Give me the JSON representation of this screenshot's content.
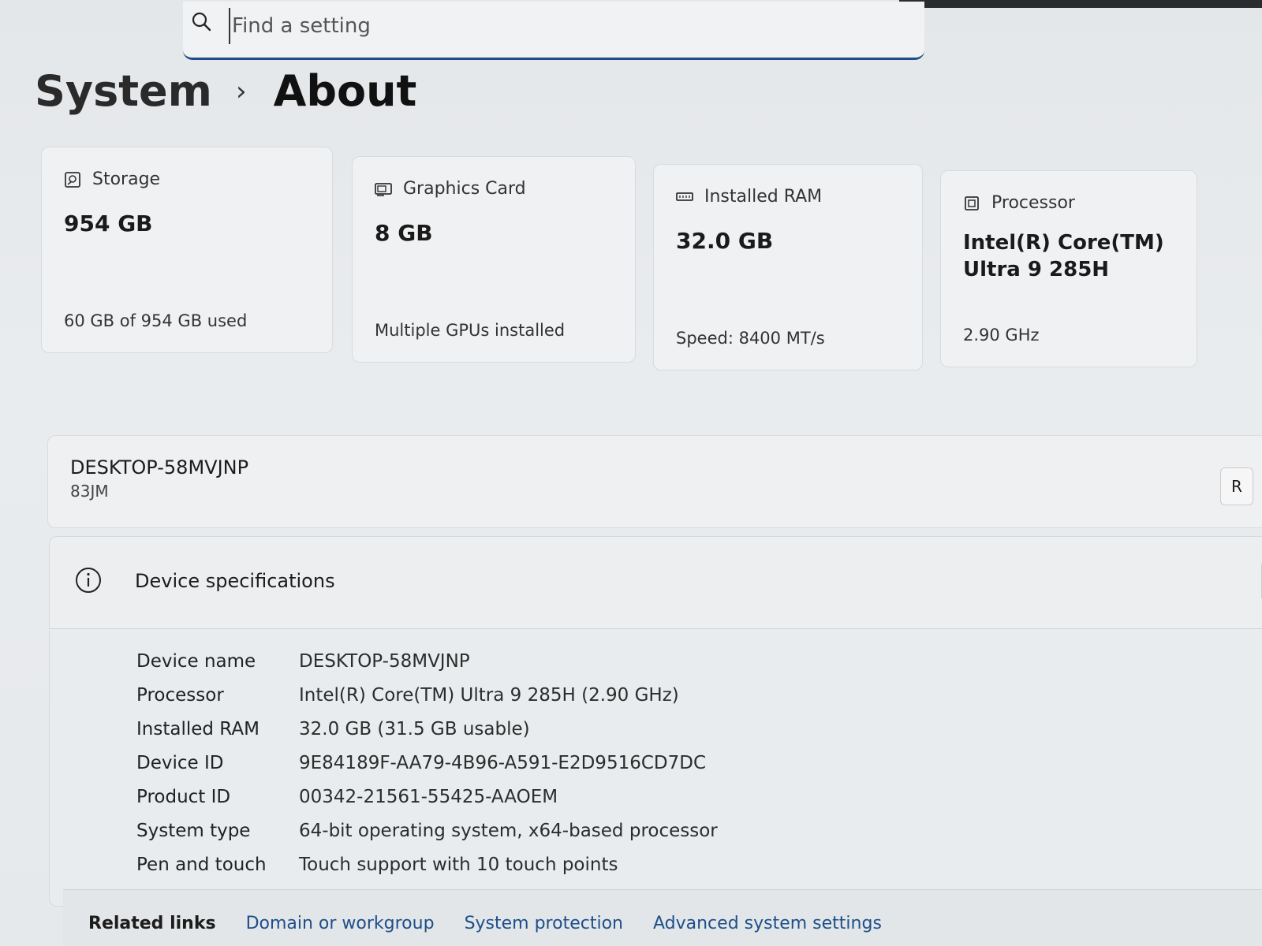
{
  "search": {
    "placeholder": "Find a setting"
  },
  "breadcrumb": {
    "parent": "System",
    "separator": "›",
    "current": "About"
  },
  "cards": [
    {
      "icon": "storage-icon",
      "label": "Storage",
      "value": "954 GB",
      "sub": "60 GB of 954 GB used"
    },
    {
      "icon": "graphics-card-icon",
      "label": "Graphics Card",
      "value": "8 GB",
      "sub": "Multiple GPUs installed"
    },
    {
      "icon": "ram-icon",
      "label": "Installed RAM",
      "value": "32.0 GB",
      "sub": "Speed: 8400 MT/s"
    },
    {
      "icon": "processor-icon",
      "label": "Processor",
      "value": "Intel(R) Core(TM) Ultra 9 285H",
      "sub": "2.90 GHz"
    }
  ],
  "device": {
    "name": "DESKTOP-58MVJNP",
    "model": "83JM",
    "rename_label": "R"
  },
  "specs": {
    "title": "Device specifications",
    "rows": [
      {
        "key": "Device name",
        "value": "DESKTOP-58MVJNP"
      },
      {
        "key": "Processor",
        "value": "Intel(R) Core(TM) Ultra 9 285H (2.90 GHz)"
      },
      {
        "key": "Installed RAM",
        "value": "32.0 GB (31.5 GB usable)"
      },
      {
        "key": "Device ID",
        "value": "9E84189F-AA79-4B96-A591-E2D9516CD7DC"
      },
      {
        "key": "Product ID",
        "value": "00342-21561-55425-AAOEM"
      },
      {
        "key": "System type",
        "value": "64-bit operating system, x64-based processor"
      },
      {
        "key": "Pen and touch",
        "value": "Touch support with 10 touch points"
      }
    ]
  },
  "related": {
    "label": "Related links",
    "links": [
      "Domain or workgroup",
      "System protection",
      "Advanced system settings"
    ]
  },
  "colors": {
    "accent": "#1f4f86",
    "link": "#1d4f8a",
    "card_bg": "#f0f1f2"
  }
}
